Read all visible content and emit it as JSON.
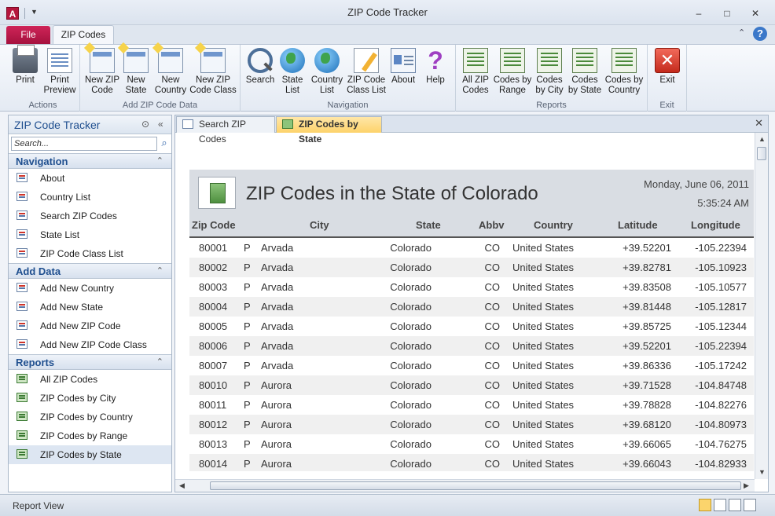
{
  "window": {
    "title": "ZIP Code Tracker",
    "app_icon": "A",
    "controls": [
      "–",
      "□",
      "✕"
    ]
  },
  "ribbon_tabs": {
    "file": "File",
    "active": "ZIP Codes"
  },
  "ribbon": {
    "groups": [
      {
        "label": "Actions",
        "buttons": [
          {
            "label": "Print",
            "icon": "printer-icon"
          },
          {
            "label": "Print Preview",
            "icon": "print-preview-icon"
          }
        ]
      },
      {
        "label": "Add ZIP Code Data",
        "buttons": [
          {
            "label": "New ZIP Code",
            "icon": "new-form-icon"
          },
          {
            "label": "New State",
            "icon": "new-form-icon"
          },
          {
            "label": "New Country",
            "icon": "new-form-icon"
          },
          {
            "label": "New ZIP Code Class",
            "icon": "new-form-icon"
          }
        ]
      },
      {
        "label": "Navigation",
        "buttons": [
          {
            "label": "Search",
            "icon": "magnifier-icon"
          },
          {
            "label": "State List",
            "icon": "globe-user-icon"
          },
          {
            "label": "Country List",
            "icon": "globe-link-icon"
          },
          {
            "label": "ZIP Code Class List",
            "icon": "edit-list-icon"
          },
          {
            "label": "About",
            "icon": "id-card-icon"
          },
          {
            "label": "Help",
            "icon": "question-icon"
          }
        ]
      },
      {
        "label": "Reports",
        "buttons": [
          {
            "label": "All ZIP Codes",
            "icon": "report-icon"
          },
          {
            "label": "Codes by Range",
            "icon": "report-icon"
          },
          {
            "label": "Codes by City",
            "icon": "report-icon"
          },
          {
            "label": "Codes by State",
            "icon": "report-icon"
          },
          {
            "label": "Codes by Country",
            "icon": "report-icon"
          }
        ]
      },
      {
        "label": "Exit",
        "buttons": [
          {
            "label": "Exit",
            "icon": "exit-icon"
          }
        ]
      }
    ]
  },
  "nav_pane": {
    "title": "ZIP Code Tracker",
    "search_placeholder": "Search...",
    "sections": [
      {
        "title": "Navigation",
        "items": [
          "About",
          "Country List",
          "Search ZIP Codes",
          "State List",
          "ZIP Code Class List"
        ]
      },
      {
        "title": "Add Data",
        "items": [
          "Add New Country",
          "Add New State",
          "Add New ZIP Code",
          "Add New ZIP Code Class"
        ]
      },
      {
        "title": "Reports",
        "items": [
          "All ZIP Codes",
          "ZIP Codes by City",
          "ZIP Codes by Country",
          "ZIP Codes by Range",
          "ZIP Codes by State"
        ]
      }
    ],
    "selected_item": "ZIP Codes by State"
  },
  "doc_tabs": [
    {
      "label": "Search ZIP Codes",
      "active": false
    },
    {
      "label": "ZIP Codes by State",
      "active": true
    }
  ],
  "report": {
    "title": "ZIP Codes in the State of Colorado",
    "date": "Monday, June 06, 2011",
    "time": "5:35:24 AM",
    "columns": [
      "Zip Code",
      "City",
      "State",
      "Abbv",
      "Country",
      "Latitude",
      "Longitude"
    ],
    "rows": [
      [
        "80001",
        "P",
        "Arvada",
        "Colorado",
        "CO",
        "United States",
        "+39.52201",
        "-105.22394"
      ],
      [
        "80002",
        "P",
        "Arvada",
        "Colorado",
        "CO",
        "United States",
        "+39.82781",
        "-105.10923"
      ],
      [
        "80003",
        "P",
        "Arvada",
        "Colorado",
        "CO",
        "United States",
        "+39.83508",
        "-105.10577"
      ],
      [
        "80004",
        "P",
        "Arvada",
        "Colorado",
        "CO",
        "United States",
        "+39.81448",
        "-105.12817"
      ],
      [
        "80005",
        "P",
        "Arvada",
        "Colorado",
        "CO",
        "United States",
        "+39.85725",
        "-105.12344"
      ],
      [
        "80006",
        "P",
        "Arvada",
        "Colorado",
        "CO",
        "United States",
        "+39.52201",
        "-105.22394"
      ],
      [
        "80007",
        "P",
        "Arvada",
        "Colorado",
        "CO",
        "United States",
        "+39.86336",
        "-105.17242"
      ],
      [
        "80010",
        "P",
        "Aurora",
        "Colorado",
        "CO",
        "United States",
        "+39.71528",
        "-104.84748"
      ],
      [
        "80011",
        "P",
        "Aurora",
        "Colorado",
        "CO",
        "United States",
        "+39.78828",
        "-104.82276"
      ],
      [
        "80012",
        "P",
        "Aurora",
        "Colorado",
        "CO",
        "United States",
        "+39.68120",
        "-104.80973"
      ],
      [
        "80013",
        "P",
        "Aurora",
        "Colorado",
        "CO",
        "United States",
        "+39.66065",
        "-104.76275"
      ],
      [
        "80014",
        "P",
        "Aurora",
        "Colorado",
        "CO",
        "United States",
        "+39.66043",
        "-104.82933"
      ]
    ]
  },
  "status_bar": {
    "text": "Report View"
  },
  "colors": {
    "file_tab": "#b5163d",
    "active_doc_tab": "#fdd36a",
    "accent_text": "#1f4f8f",
    "report_header": "#d9dde3"
  }
}
